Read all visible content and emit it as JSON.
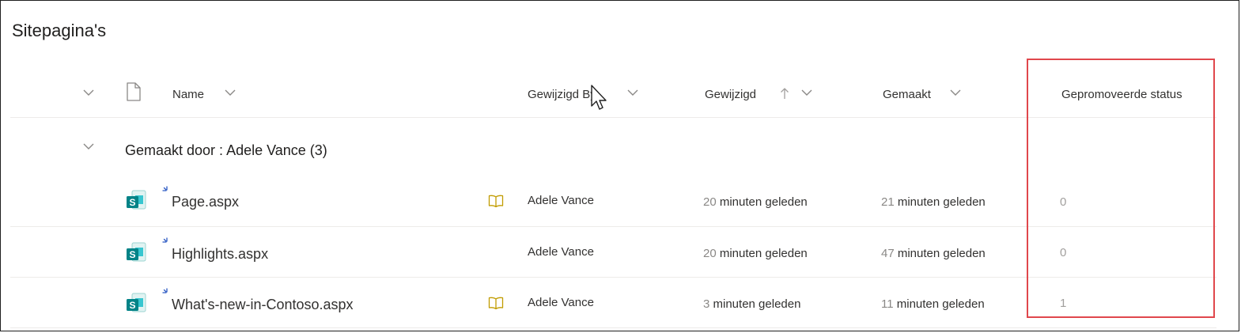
{
  "page_title": "Sitepagina's",
  "header": {
    "name": "Name",
    "modified_by": "Gewijzigd By",
    "modified": "Gewijzigd",
    "created": "Gemaakt",
    "promoted_state": "Gepromoveerde status"
  },
  "group": {
    "label": "Gemaakt door : Adele Vance (3)"
  },
  "rows": [
    {
      "name": "Page.aspx",
      "modified_by": "Adele Vance",
      "modified_num": "20",
      "modified_unit": "minuten geleden",
      "created_num": "21",
      "created_unit": "minuten geleden",
      "status": "0",
      "has_note": true
    },
    {
      "name": "Highlights.aspx",
      "modified_by": "Adele Vance",
      "modified_num": "20",
      "modified_unit": "minuten geleden",
      "created_num": "47",
      "created_unit": "minuten geleden",
      "status": "0",
      "has_note": false
    },
    {
      "name": "What's-new-in-Contoso.aspx",
      "modified_by": "Adele Vance",
      "modified_num": "3",
      "modified_unit": "minuten geleden",
      "created_num": "11",
      "created_unit": "minuten geleden",
      "status": "1",
      "has_note": true
    }
  ],
  "icons": {
    "file_type": "sharepoint-page-icon",
    "new_item": "new-item-sparkle-icon",
    "note": "book-icon",
    "sort_ascending": "arrow-up-icon",
    "cursor": "mouse-cursor-icon"
  },
  "colors": {
    "highlight_border": "#e0474c",
    "sharepoint_teal": "#038387",
    "sparkle_blue": "#2b59c3",
    "note_gold": "#c19c00"
  }
}
